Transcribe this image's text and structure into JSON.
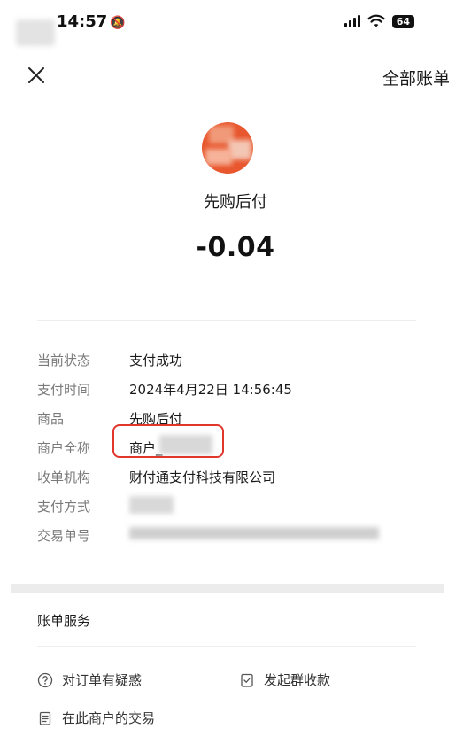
{
  "status_bar": {
    "time": "14:57",
    "battery": "64"
  },
  "header": {
    "all_bills": "全部账单"
  },
  "merchant": {
    "name": "先购后付",
    "amount": "-0.04"
  },
  "details": [
    {
      "label": "当前状态",
      "value": "支付成功"
    },
    {
      "label": "支付时间",
      "value": "2024年4月22日 14:56:45"
    },
    {
      "label": "商品",
      "value": "先购后付"
    },
    {
      "label": "商户全称",
      "value": "商户_"
    },
    {
      "label": "收单机构",
      "value": "财付通支付科技有限公司"
    },
    {
      "label": "支付方式",
      "value": ""
    },
    {
      "label": "交易单号",
      "value": ""
    }
  ],
  "services": {
    "title": "账单服务",
    "question": "对订单有疑惑",
    "group_collect": "发起群收款",
    "merchant_trades": "在此商户的交易"
  }
}
